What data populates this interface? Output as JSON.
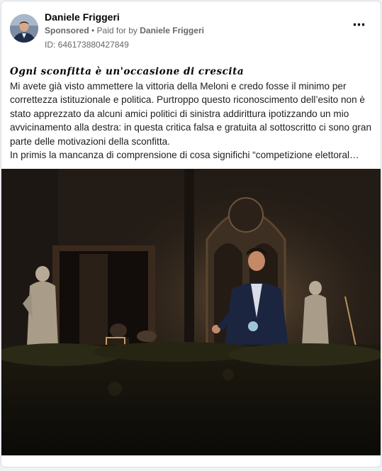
{
  "post": {
    "author_name": "Daniele Friggeri",
    "sponsored_label": "Sponsored",
    "separator": " • ",
    "paid_for_prefix": "Paid for by ",
    "paid_for_by": "Daniele Friggeri",
    "ad_id": "ID: 646173880427849",
    "more_icon": "⋯",
    "headline": "Ogni sconfitta è un'occasione di crescita",
    "paragraph1": "Mi avete già visto ammettere la vittoria della Meloni e credo fosse il minimo per correttezza istituzionale e politica. Purtroppo questo riconoscimento dell’esito non è stato apprezzato da alcuni amici politici di sinistra addirittura ipotizzando un mio avvicinamento alla destra: in questa critica falsa e gratuita al sottoscritto ci sono gran parte delle motivazioni della sconfitta.",
    "paragraph2": "In primis la mancanza di comprensione di cosa significhi “competizione elettoral…"
  },
  "colors": {
    "background": "#f0f2f5",
    "card": "#ffffff",
    "secondary_text": "#65676b"
  },
  "icons": {
    "more": "more-options-icon"
  }
}
